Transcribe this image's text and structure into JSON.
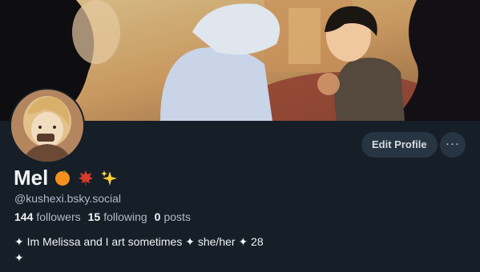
{
  "profile": {
    "display_name": "Mel",
    "emoji": [
      "orange-emoji",
      "maple-leaf-emoji",
      "sparkles-emoji"
    ],
    "handle": "@kushexi.bsky.social",
    "stats": {
      "followers_count": "144",
      "followers_label": "followers",
      "following_count": "15",
      "following_label": "following",
      "posts_count": "0",
      "posts_label": "posts"
    },
    "bio": "✦ Im Melissa and I art sometimes ✦ she/her ✦ 28\n✦"
  },
  "actions": {
    "edit_profile_label": "Edit Profile",
    "more_label": "···"
  },
  "colors": {
    "background": "#161e27",
    "button_bg": "#273441",
    "secondary_text": "#aebbc9"
  }
}
